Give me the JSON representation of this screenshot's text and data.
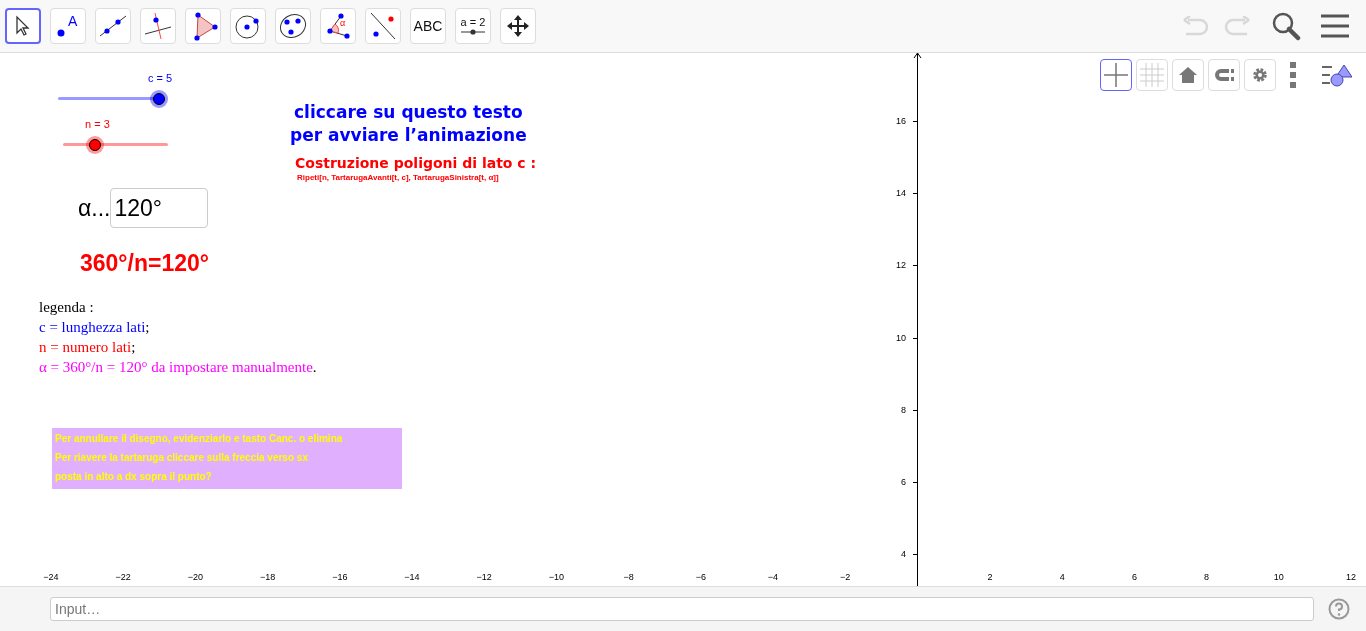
{
  "toolbar": {
    "tools": [
      {
        "kind": "move",
        "selected": true
      },
      {
        "kind": "point",
        "label": "A",
        "selected": false
      },
      {
        "kind": "line",
        "selected": false
      },
      {
        "kind": "perpendicular",
        "selected": false
      },
      {
        "kind": "polygon",
        "selected": false
      },
      {
        "kind": "circle",
        "selected": false
      },
      {
        "kind": "conic",
        "selected": false
      },
      {
        "kind": "angle",
        "label": "α",
        "selected": false
      },
      {
        "kind": "reflect",
        "selected": false
      },
      {
        "kind": "text",
        "label": "ABC",
        "selected": false
      },
      {
        "kind": "slider",
        "label": "a = 2",
        "selected": false
      },
      {
        "kind": "move_view",
        "selected": false
      }
    ],
    "undo": {
      "disabled": true
    },
    "redo": {
      "disabled": true
    }
  },
  "style_bar": [
    {
      "kind": "axes",
      "selected": true
    },
    {
      "kind": "grid",
      "selected": false
    },
    {
      "kind": "home",
      "selected": false
    },
    {
      "kind": "magnet",
      "selected": false
    },
    {
      "kind": "settings",
      "selected": false
    }
  ],
  "sliders": [
    {
      "label": "c = 5",
      "color": "#0000ff",
      "level": 1
    },
    {
      "label": "n = 3",
      "color": "#ff0000",
      "level": 0.3
    }
  ],
  "alpha_field": {
    "label": "α...",
    "value": "120°"
  },
  "formula": "360°/n=120°",
  "animation_text": "cliccare su questo testo\nper avviare l’animazione",
  "construction_title": "Costruzione poligoni di lato c :",
  "construction_command": "Ripeti[n, TartarugaAvanti[t, c], TartarugaSinistra[t, α]]",
  "legend": [
    {
      "text": "legenda :",
      "color": "#000000"
    },
    {
      "text": "c = lunghezza lati",
      "color": "#0000ff",
      "suffix": ";"
    },
    {
      "text": "n = numero lati",
      "color": "#ff0000",
      "suffix": ";"
    },
    {
      "text": "α =  360°/n = 120° da impostare manualmente",
      "color": "#ff00ff",
      "suffix": "."
    }
  ],
  "note": "Per annullare il disegno, evidenziarlo e tasto Canc. o elimina\nPer riavere la tartaruga cliccare sulla freccia verso sx\nposta in alto a dx sopra il punto?",
  "x_axis": {
    "negative_labels": [
      "−24",
      "−22",
      "−20",
      "−18",
      "−16",
      "−14",
      "−12",
      "−10",
      "−8",
      "−6",
      "−4",
      "−2"
    ],
    "positive_labels": [
      "2",
      "4",
      "6",
      "8",
      "10",
      "12"
    ]
  },
  "y_axis": {
    "labels": [
      "16",
      "14",
      "12",
      "10",
      "8",
      "6",
      "4"
    ]
  },
  "input_bar": {
    "placeholder": "Input…"
  }
}
